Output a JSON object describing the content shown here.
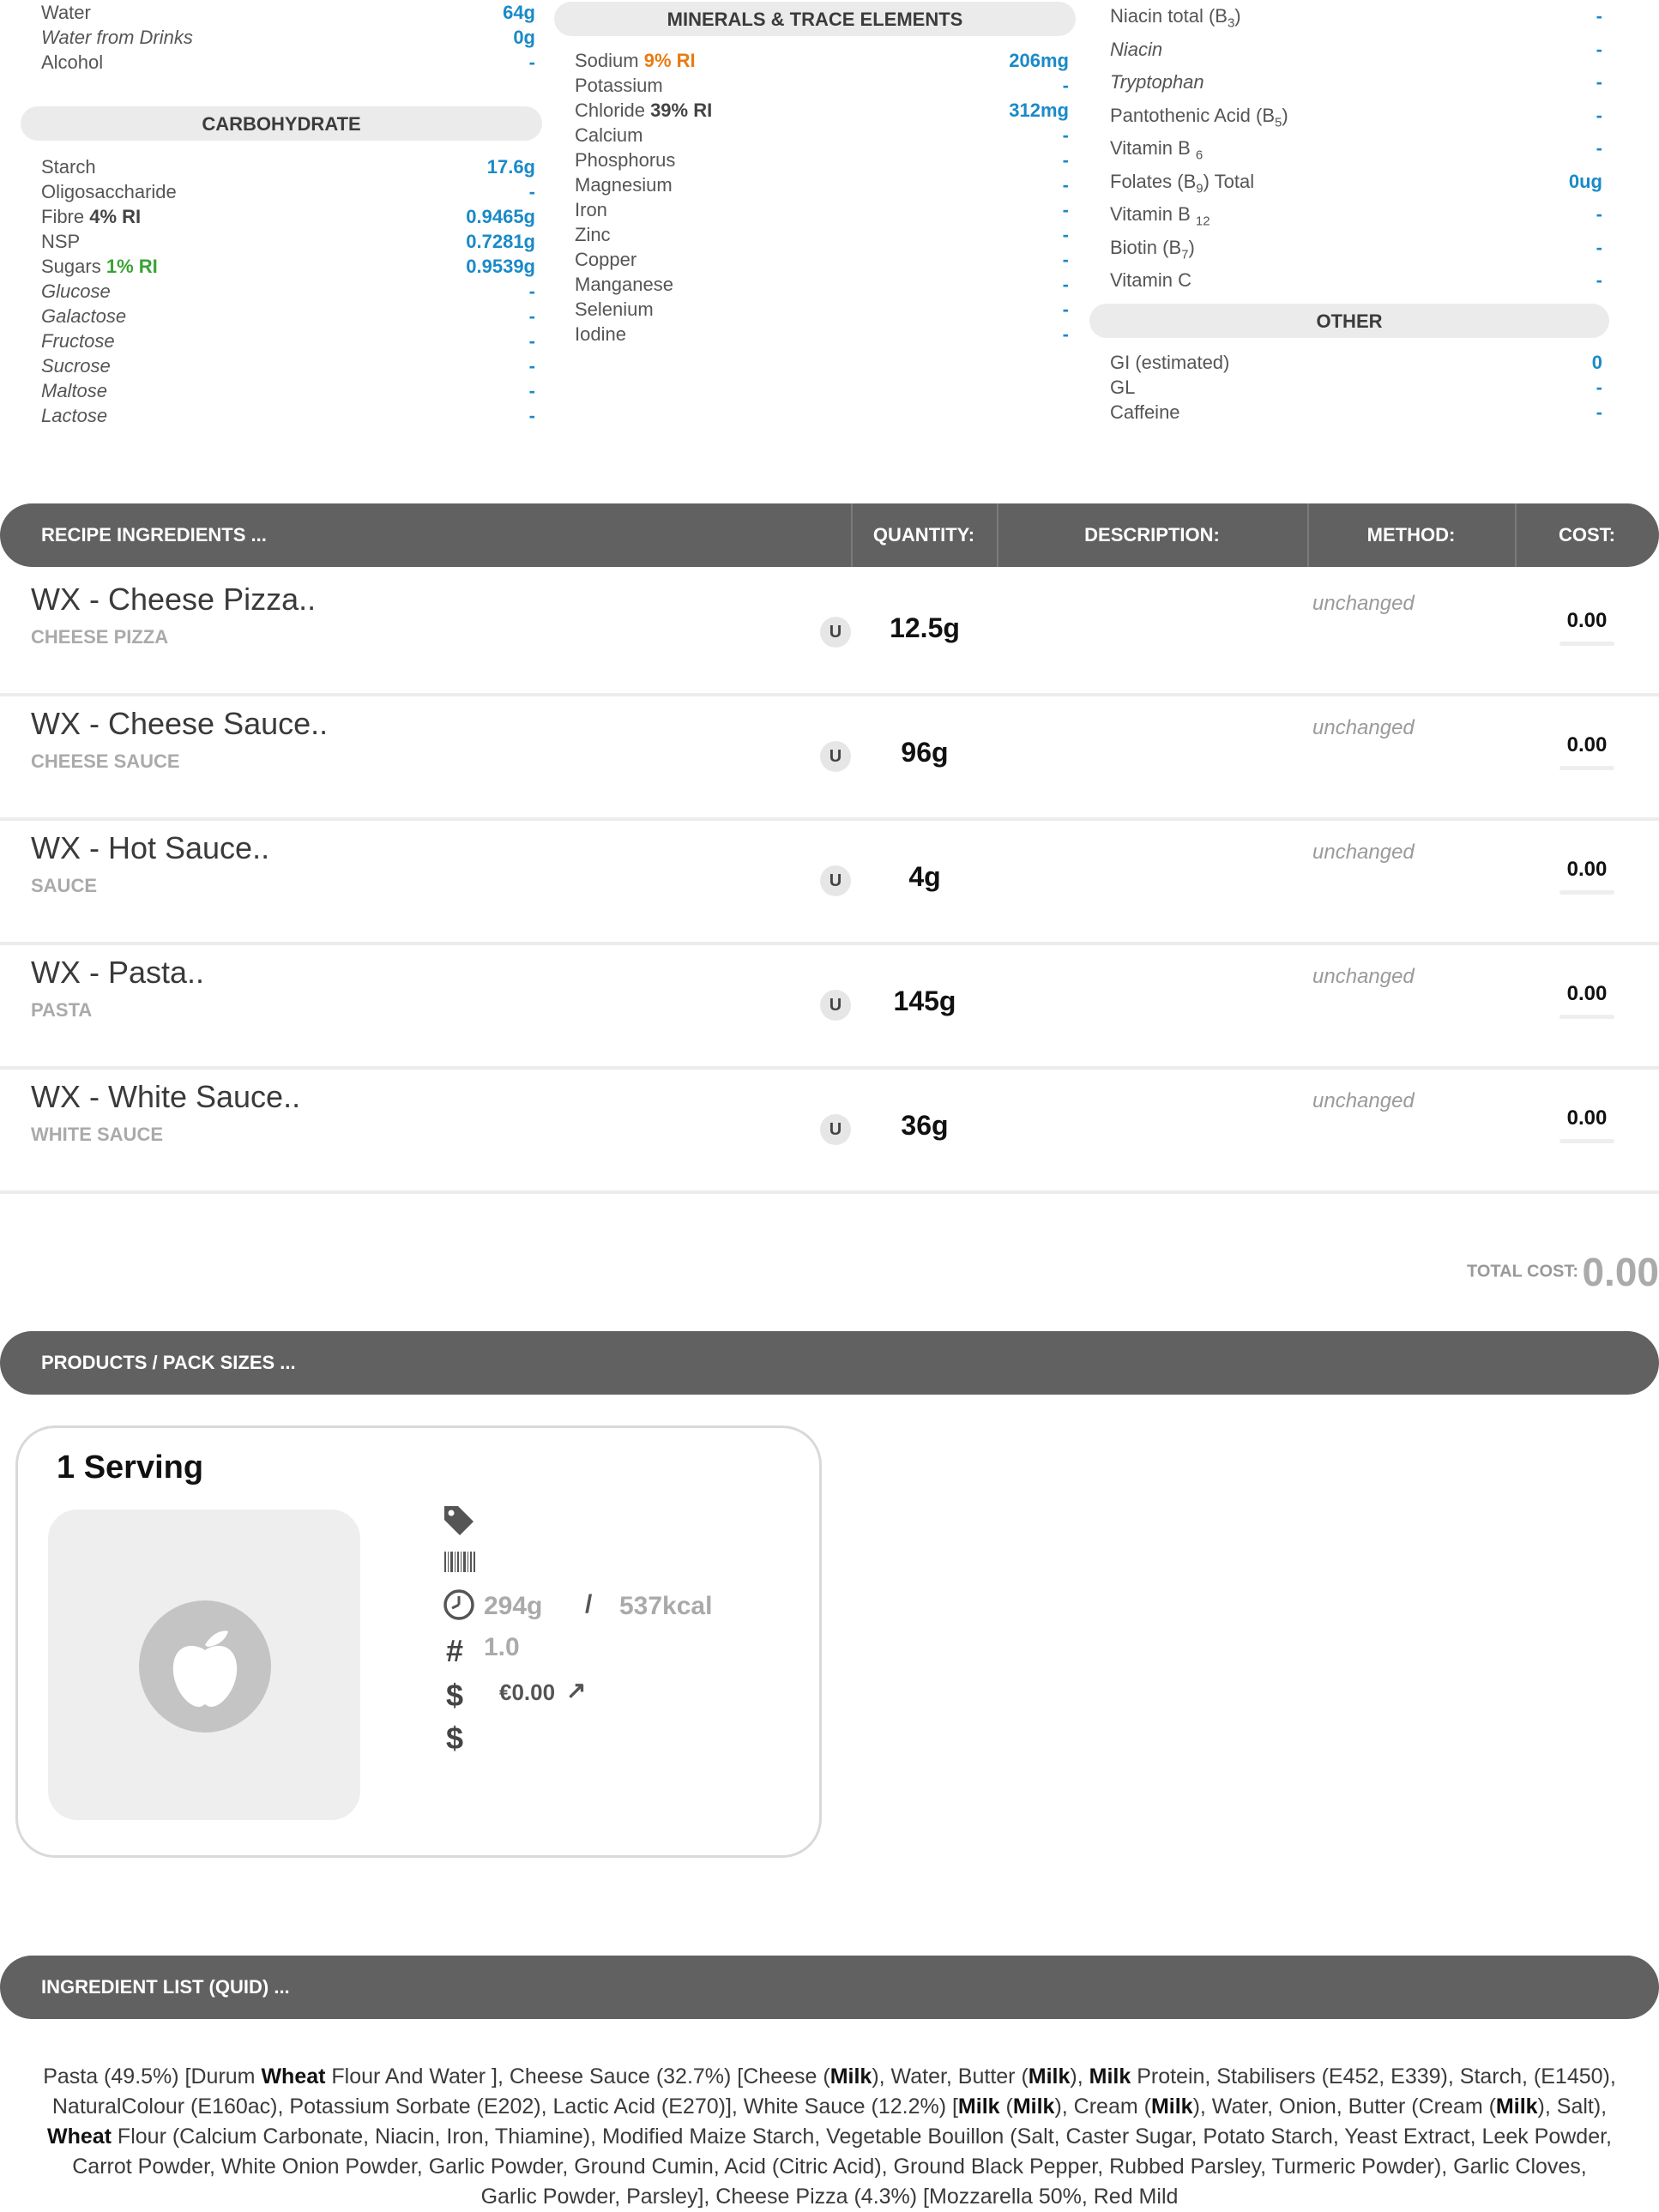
{
  "nutrients": {
    "col1_top": [
      {
        "label": "Water",
        "value": "64g",
        "italic": false
      },
      {
        "label": "Water from Drinks",
        "value": "0g",
        "italic": true
      },
      {
        "label": "Alcohol",
        "value": "-",
        "italic": false
      }
    ],
    "carbohydrate": {
      "header": "CARBOHYDRATE",
      "rows": [
        {
          "label": "Starch",
          "value": "17.6g",
          "italic": false
        },
        {
          "label": "Oligosaccharide",
          "value": "-",
          "italic": false
        },
        {
          "label": "Fibre",
          "ri": "4% RI",
          "value": "0.9465g",
          "italic": false
        },
        {
          "label": "NSP",
          "value": "0.7281g",
          "italic": false
        },
        {
          "label": "Sugars",
          "ri": "1% RI",
          "value": "0.9539g",
          "italic": false
        },
        {
          "label": "Glucose",
          "value": "-",
          "italic": true
        },
        {
          "label": "Galactose",
          "value": "-",
          "italic": true
        },
        {
          "label": "Fructose",
          "value": "-",
          "italic": true
        },
        {
          "label": "Sucrose",
          "value": "-",
          "italic": true
        },
        {
          "label": "Maltose",
          "value": "-",
          "italic": true
        },
        {
          "label": "Lactose",
          "value": "-",
          "italic": true
        }
      ]
    },
    "minerals": {
      "header": "MINERALS & TRACE ELEMENTS",
      "rows": [
        {
          "label": "Sodium",
          "ri": "9% RI",
          "value": "206mg"
        },
        {
          "label": "Potassium",
          "value": "-"
        },
        {
          "label": "Chloride",
          "ri": "39% RI",
          "value": "312mg"
        },
        {
          "label": "Calcium",
          "value": "-"
        },
        {
          "label": "Phosphorus",
          "value": "-"
        },
        {
          "label": "Magnesium",
          "value": "-"
        },
        {
          "label": "Iron",
          "value": "-"
        },
        {
          "label": "Zinc",
          "value": "-"
        },
        {
          "label": "Copper",
          "value": "-"
        },
        {
          "label": "Manganese",
          "value": "-"
        },
        {
          "label": "Selenium",
          "value": "-"
        },
        {
          "label": "Iodine",
          "value": "-"
        }
      ]
    },
    "vitamins": [
      {
        "label": "Niacin total (B",
        "sub": "3",
        "tail": ")",
        "value": "-",
        "italic": false
      },
      {
        "label": "Niacin",
        "value": "-",
        "italic": true
      },
      {
        "label": "Tryptophan",
        "value": "-",
        "italic": true
      },
      {
        "label": "Pantothenic Acid (B",
        "sub": "5",
        "tail": ")",
        "value": "-",
        "italic": false
      },
      {
        "label": "Vitamin B ",
        "sub": "6",
        "tail": "",
        "value": "-",
        "italic": false
      },
      {
        "label": "Folates (B",
        "sub": "9",
        "tail": ") Total",
        "value": "0ug",
        "italic": false
      },
      {
        "label": "Vitamin B ",
        "sub": "12",
        "tail": "",
        "value": "-",
        "italic": false
      },
      {
        "label": "Biotin (B",
        "sub": "7",
        "tail": ")",
        "value": "-",
        "italic": false
      },
      {
        "label": "Vitamin C",
        "value": "-",
        "italic": false
      }
    ],
    "other": {
      "header": "OTHER",
      "rows": [
        {
          "label": "GI (estimated)",
          "value": "0"
        },
        {
          "label": "GL",
          "value": "-"
        },
        {
          "label": "Caffeine",
          "value": "-"
        }
      ]
    }
  },
  "recipe": {
    "header": {
      "ingredients": "RECIPE INGREDIENTS ...",
      "quantity": "QUANTITY:",
      "description": "DESCRIPTION:",
      "method": "METHOD:",
      "cost": "COST:"
    },
    "items": [
      {
        "name": "WX - Cheese Pizza..",
        "category": "CHEESE PIZZA",
        "unit": "U",
        "quantity": "12.5g",
        "method": "unchanged",
        "cost": "0.00"
      },
      {
        "name": "WX - Cheese Sauce..",
        "category": "CHEESE SAUCE",
        "unit": "U",
        "quantity": "96g",
        "method": "unchanged",
        "cost": "0.00"
      },
      {
        "name": "WX - Hot Sauce..",
        "category": "SAUCE",
        "unit": "U",
        "quantity": "4g",
        "method": "unchanged",
        "cost": "0.00"
      },
      {
        "name": "WX - Pasta..",
        "category": "PASTA",
        "unit": "U",
        "quantity": "145g",
        "method": "unchanged",
        "cost": "0.00"
      },
      {
        "name": "WX - White Sauce..",
        "category": "WHITE SAUCE",
        "unit": "U",
        "quantity": "36g",
        "method": "unchanged",
        "cost": "0.00"
      }
    ],
    "total_label": "TOTAL COST:",
    "total_value": "0.00"
  },
  "products": {
    "header": "PRODUCTS / PACK SIZES ...",
    "card": {
      "title": "1 Serving",
      "weight": "294g",
      "separator": "/",
      "energy": "537kcal",
      "count": "1.0",
      "price": "€0.00",
      "price_arrow": "↗",
      "hash_symbol": "#",
      "dollar_symbol": "$"
    }
  },
  "quid": {
    "header": "INGREDIENT LIST (QUID) ...",
    "segments": [
      {
        "t": "Pasta (49.5%) [Durum "
      },
      {
        "t": "Wheat",
        "b": true
      },
      {
        "t": " Flour And Water ], Cheese Sauce (32.7%) [Cheese ("
      },
      {
        "t": "Milk",
        "b": true
      },
      {
        "t": "), Water, Butter ("
      },
      {
        "t": "Milk",
        "b": true
      },
      {
        "t": "), "
      },
      {
        "t": "Milk",
        "b": true
      },
      {
        "t": " Protein, Stabilisers (E452, E339), Starch, (E1450), NaturalColour (E160ac), Potassium Sorbate (E202), Lactic Acid (E270)], White Sauce (12.2%) ["
      },
      {
        "t": "Milk",
        "b": true
      },
      {
        "t": " ("
      },
      {
        "t": "Milk",
        "b": true
      },
      {
        "t": "), Cream ("
      },
      {
        "t": "Milk",
        "b": true
      },
      {
        "t": "), Water, Onion, Butter (Cream ("
      },
      {
        "t": "Milk",
        "b": true
      },
      {
        "t": "), Salt), "
      },
      {
        "t": "Wheat",
        "b": true
      },
      {
        "t": " Flour (Calcium Carbonate, Niacin, Iron, Thiamine), Modified Maize Starch, Vegetable Bouillon (Salt, Caster Sugar, Potato Starch, Yeast Extract, Leek Powder, Carrot Powder, White Onion Powder, Garlic Powder, Ground Cumin, Acid (Citric Acid), Ground Black Pepper, Rubbed Parsley, Turmeric Powder), Garlic Cloves, Garlic Powder, Parsley], Cheese Pizza (4.3%) [Mozzarella 50%, Red Mild"
      }
    ]
  },
  "colors": {
    "value_blue": "#1a8ac8",
    "ri_orange": "#e87b12",
    "ri_green": "#3aa335",
    "bar_grey": "#616161"
  },
  "icons": [
    "tag-icon",
    "barcode-icon",
    "clock-icon",
    "hash-icon",
    "dollar-icon",
    "apple-icon"
  ]
}
